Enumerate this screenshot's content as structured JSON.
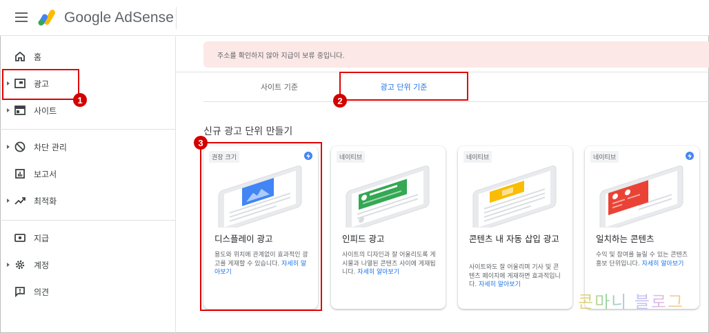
{
  "header": {
    "logo_text": "Google AdSense"
  },
  "sidebar": {
    "items": [
      {
        "label": "홈",
        "icon": "home-icon",
        "arrow": false
      },
      {
        "label": "광고",
        "icon": "ads-icon",
        "arrow": true
      },
      {
        "label": "사이트",
        "icon": "sites-icon",
        "arrow": true
      },
      {
        "label": "차단 관리",
        "icon": "block-icon",
        "arrow": true
      },
      {
        "label": "보고서",
        "icon": "reports-icon",
        "arrow": false
      },
      {
        "label": "최적화",
        "icon": "optimize-icon",
        "arrow": true
      },
      {
        "label": "지급",
        "icon": "payments-icon",
        "arrow": false
      },
      {
        "label": "계정",
        "icon": "gear-icon",
        "arrow": true
      },
      {
        "label": "의견",
        "icon": "feedback-icon",
        "arrow": false
      }
    ]
  },
  "alert": {
    "text": "주소를 확인하지 않아 지급이 보류 중입니다."
  },
  "tabs": [
    {
      "label": "사이트 기준"
    },
    {
      "label": "광고 단위 기준"
    }
  ],
  "section_title": "신규 광고 단위 만들기",
  "cards": [
    {
      "badge": "권장 크기",
      "bolt": true,
      "title": "디스플레이 광고",
      "desc": "용도와 위치에 관계없이 효과적인 광고를 게재할 수 있습니다.",
      "link": "자세히 알아보기",
      "color": "#4285f4"
    },
    {
      "badge": "네이티브",
      "bolt": false,
      "title": "인피드 광고",
      "desc": "사이트의 디자인과 잘 어울리도록 게시물과 나열된 콘텐츠 사이에 게재됩니다.",
      "link": "자세히 알아보기",
      "color": "#34a853"
    },
    {
      "badge": "네이티브",
      "bolt": false,
      "title": "콘텐츠 내 자동 삽입 광고",
      "desc": "사이트와도 잘 어울리며 기사 및 콘텐츠 페이지에 게재하면 효과적입니다.",
      "link": "자세히 알아보기",
      "color": "#fbbc04"
    },
    {
      "badge": "네이티브",
      "bolt": true,
      "title": "일치하는 콘텐츠",
      "desc": "수익 및 참여를 늘릴 수 있는 콘텐츠 홍보 단위입니다.",
      "link": "자세히 알아보기",
      "color": "#ea4335"
    }
  ],
  "annotations": [
    "1",
    "2",
    "3"
  ],
  "watermark": "콘마니 블로그"
}
